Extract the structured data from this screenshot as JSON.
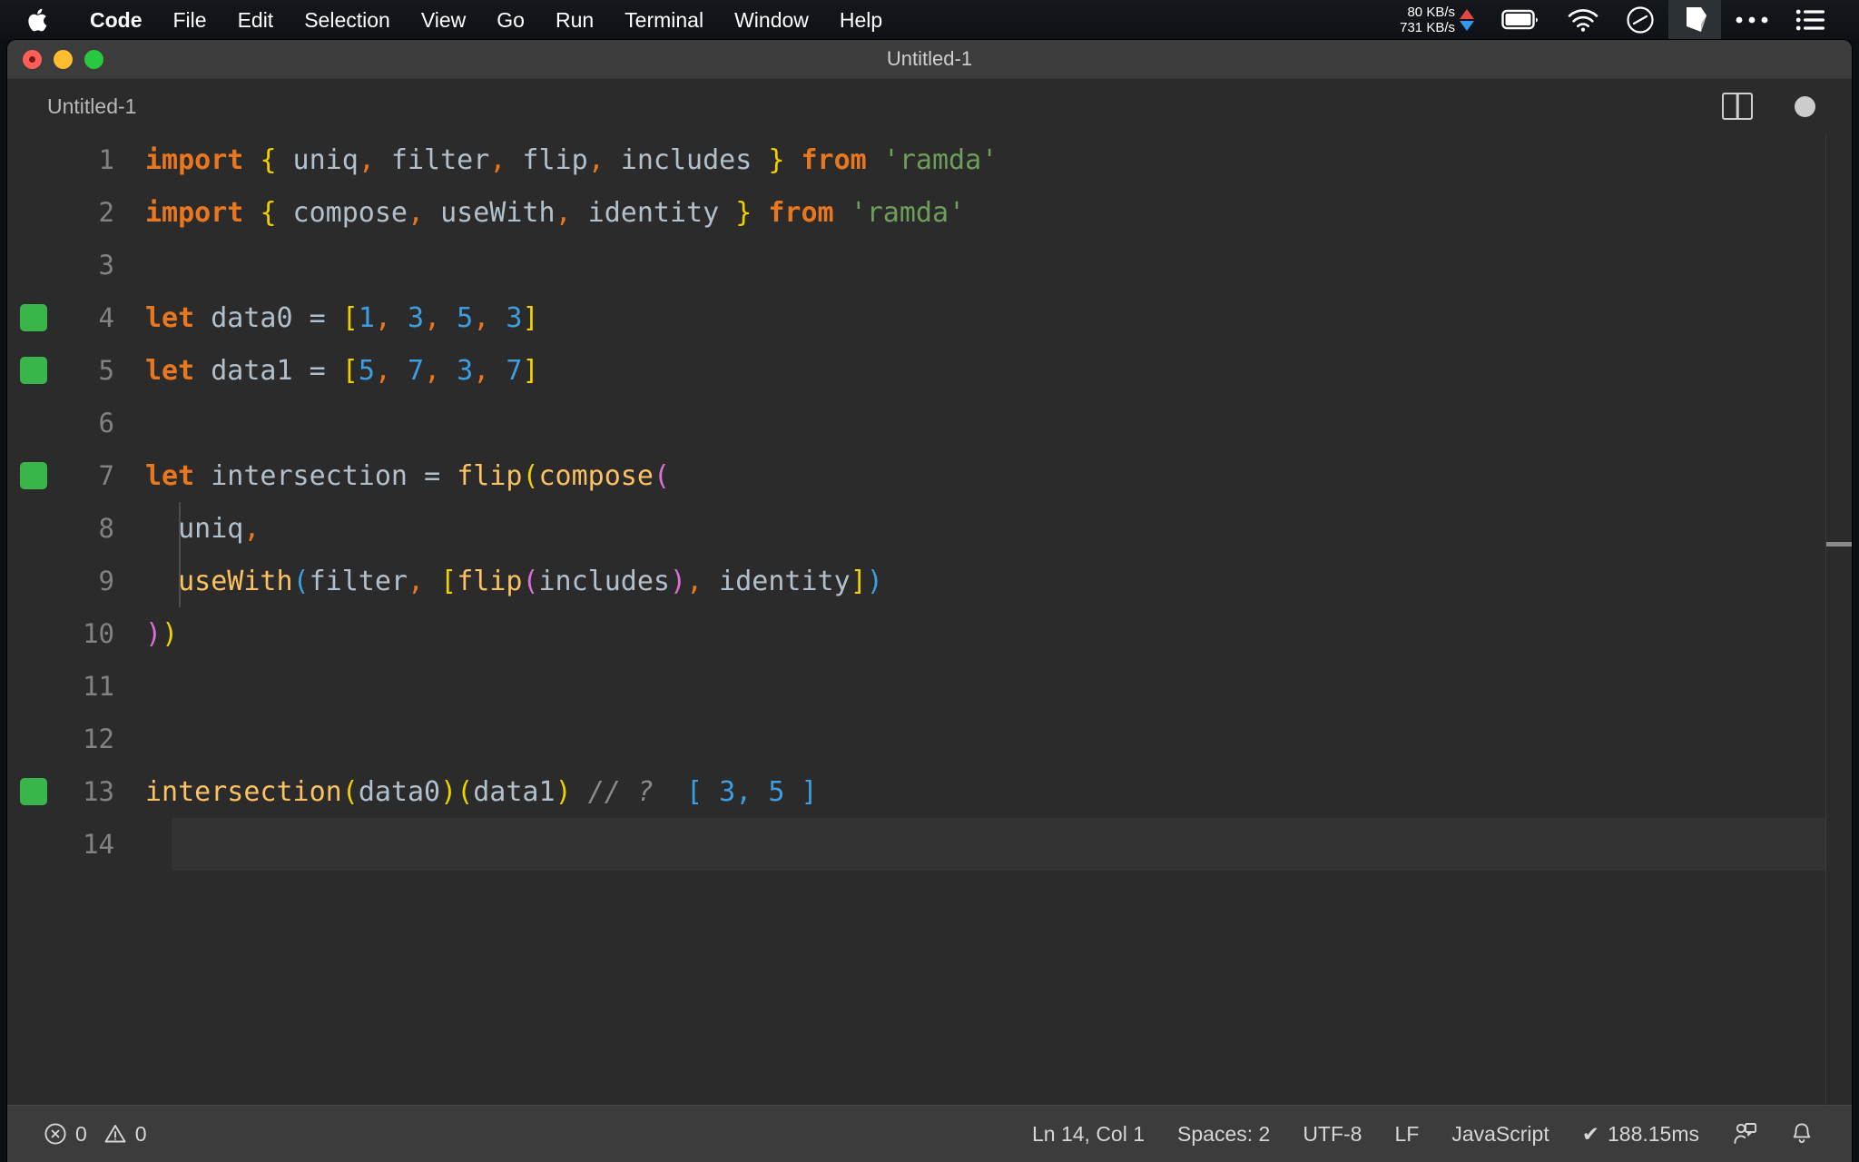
{
  "menubar": {
    "apple_icon": "apple-logo-icon",
    "items": [
      {
        "label": "Code",
        "bold": true
      },
      {
        "label": "File",
        "bold": false
      },
      {
        "label": "Edit",
        "bold": false
      },
      {
        "label": "Selection",
        "bold": false
      },
      {
        "label": "View",
        "bold": false
      },
      {
        "label": "Go",
        "bold": false
      },
      {
        "label": "Run",
        "bold": false
      },
      {
        "label": "Terminal",
        "bold": false
      },
      {
        "label": "Window",
        "bold": false
      },
      {
        "label": "Help",
        "bold": false
      }
    ],
    "network": {
      "upload": "80 KB/s",
      "download": "731 KB/s",
      "upload_color": "#e8453c",
      "download_color": "#2f9bf0"
    },
    "tray_icons": [
      "battery-icon",
      "wifi-icon",
      "do-not-disturb-icon",
      "dropbox-icon",
      "ellipsis-icon",
      "control-center-icon"
    ]
  },
  "window": {
    "title": "Untitled-1",
    "traffic_lights": [
      "close-button",
      "minimize-button",
      "maximize-button"
    ]
  },
  "tabbar": {
    "tabs": [
      {
        "label": "Untitled-1",
        "active": true
      }
    ],
    "actions": [
      "split-editor-icon",
      "unsaved-indicator"
    ]
  },
  "editor": {
    "language": "JavaScript",
    "current_line": 14,
    "lines": [
      {
        "n": "1",
        "marker": false,
        "indent_guide": false,
        "tokens": [
          {
            "t": "import",
            "c": "t-kw"
          },
          {
            "t": " ",
            "c": "t-id"
          },
          {
            "t": "{",
            "c": "b1"
          },
          {
            "t": " uniq",
            "c": "t-id"
          },
          {
            "t": ",",
            "c": "t-punc"
          },
          {
            "t": " filter",
            "c": "t-id"
          },
          {
            "t": ",",
            "c": "t-punc"
          },
          {
            "t": " flip",
            "c": "t-id"
          },
          {
            "t": ",",
            "c": "t-punc"
          },
          {
            "t": " includes ",
            "c": "t-id"
          },
          {
            "t": "}",
            "c": "b1"
          },
          {
            "t": " ",
            "c": "t-id"
          },
          {
            "t": "from",
            "c": "t-kw"
          },
          {
            "t": " ",
            "c": "t-id"
          },
          {
            "t": "'ramda'",
            "c": "t-str"
          }
        ]
      },
      {
        "n": "2",
        "marker": false,
        "indent_guide": false,
        "tokens": [
          {
            "t": "import",
            "c": "t-kw"
          },
          {
            "t": " ",
            "c": "t-id"
          },
          {
            "t": "{",
            "c": "b1"
          },
          {
            "t": " compose",
            "c": "t-id"
          },
          {
            "t": ",",
            "c": "t-punc"
          },
          {
            "t": " useWith",
            "c": "t-id"
          },
          {
            "t": ",",
            "c": "t-punc"
          },
          {
            "t": " identity ",
            "c": "t-id"
          },
          {
            "t": "}",
            "c": "b1"
          },
          {
            "t": " ",
            "c": "t-id"
          },
          {
            "t": "from",
            "c": "t-kw"
          },
          {
            "t": " ",
            "c": "t-id"
          },
          {
            "t": "'ramda'",
            "c": "t-str"
          }
        ]
      },
      {
        "n": "3",
        "marker": false,
        "indent_guide": false,
        "tokens": []
      },
      {
        "n": "4",
        "marker": true,
        "indent_guide": false,
        "tokens": [
          {
            "t": "let",
            "c": "t-kw"
          },
          {
            "t": " data0 ",
            "c": "t-id"
          },
          {
            "t": "=",
            "c": "t-op"
          },
          {
            "t": " ",
            "c": "t-id"
          },
          {
            "t": "[",
            "c": "b1"
          },
          {
            "t": "1",
            "c": "t-num"
          },
          {
            "t": ",",
            "c": "t-punc"
          },
          {
            "t": " 3",
            "c": "t-num"
          },
          {
            "t": ",",
            "c": "t-punc"
          },
          {
            "t": " 5",
            "c": "t-num"
          },
          {
            "t": ",",
            "c": "t-punc"
          },
          {
            "t": " 3",
            "c": "t-num"
          },
          {
            "t": "]",
            "c": "b1"
          }
        ]
      },
      {
        "n": "5",
        "marker": true,
        "indent_guide": false,
        "tokens": [
          {
            "t": "let",
            "c": "t-kw"
          },
          {
            "t": " data1 ",
            "c": "t-id"
          },
          {
            "t": "=",
            "c": "t-op"
          },
          {
            "t": " ",
            "c": "t-id"
          },
          {
            "t": "[",
            "c": "b1"
          },
          {
            "t": "5",
            "c": "t-num"
          },
          {
            "t": ",",
            "c": "t-punc"
          },
          {
            "t": " 7",
            "c": "t-num"
          },
          {
            "t": ",",
            "c": "t-punc"
          },
          {
            "t": " 3",
            "c": "t-num"
          },
          {
            "t": ",",
            "c": "t-punc"
          },
          {
            "t": " 7",
            "c": "t-num"
          },
          {
            "t": "]",
            "c": "b1"
          }
        ]
      },
      {
        "n": "6",
        "marker": false,
        "indent_guide": false,
        "tokens": []
      },
      {
        "n": "7",
        "marker": true,
        "indent_guide": false,
        "tokens": [
          {
            "t": "let",
            "c": "t-kw"
          },
          {
            "t": " intersection ",
            "c": "t-id"
          },
          {
            "t": "=",
            "c": "t-op"
          },
          {
            "t": " ",
            "c": "t-id"
          },
          {
            "t": "flip",
            "c": "t-fn"
          },
          {
            "t": "(",
            "c": "b1"
          },
          {
            "t": "compose",
            "c": "t-fn"
          },
          {
            "t": "(",
            "c": "b2"
          }
        ]
      },
      {
        "n": "8",
        "marker": false,
        "indent_guide": true,
        "tokens": [
          {
            "t": "  uniq",
            "c": "t-id"
          },
          {
            "t": ",",
            "c": "t-punc"
          }
        ]
      },
      {
        "n": "9",
        "marker": false,
        "indent_guide": true,
        "tokens": [
          {
            "t": "  ",
            "c": "t-id"
          },
          {
            "t": "useWith",
            "c": "t-fn"
          },
          {
            "t": "(",
            "c": "b3"
          },
          {
            "t": "filter",
            "c": "t-id"
          },
          {
            "t": ",",
            "c": "t-punc"
          },
          {
            "t": " ",
            "c": "t-id"
          },
          {
            "t": "[",
            "c": "b1"
          },
          {
            "t": "flip",
            "c": "t-fn"
          },
          {
            "t": "(",
            "c": "b2"
          },
          {
            "t": "includes",
            "c": "t-id"
          },
          {
            "t": ")",
            "c": "b2"
          },
          {
            "t": ",",
            "c": "t-punc"
          },
          {
            "t": " identity",
            "c": "t-id"
          },
          {
            "t": "]",
            "c": "b1"
          },
          {
            "t": ")",
            "c": "b3"
          }
        ]
      },
      {
        "n": "10",
        "marker": false,
        "indent_guide": false,
        "tokens": [
          {
            "t": ")",
            "c": "b2"
          },
          {
            "t": ")",
            "c": "b1"
          }
        ]
      },
      {
        "n": "11",
        "marker": false,
        "indent_guide": false,
        "tokens": []
      },
      {
        "n": "12",
        "marker": false,
        "indent_guide": false,
        "tokens": []
      },
      {
        "n": "13",
        "marker": true,
        "indent_guide": false,
        "tokens": [
          {
            "t": "intersection",
            "c": "t-fn"
          },
          {
            "t": "(",
            "c": "b1"
          },
          {
            "t": "data0",
            "c": "t-id"
          },
          {
            "t": ")",
            "c": "b1"
          },
          {
            "t": "(",
            "c": "b1"
          },
          {
            "t": "data1",
            "c": "t-id"
          },
          {
            "t": ")",
            "c": "b1"
          },
          {
            "t": " ",
            "c": "t-id"
          },
          {
            "t": "// ?",
            "c": "t-com"
          },
          {
            "t": "  [ 3, 5 ]",
            "c": "t-res"
          }
        ]
      },
      {
        "n": "14",
        "marker": false,
        "indent_guide": false,
        "current": true,
        "tokens": []
      }
    ]
  },
  "statusbar": {
    "errors_icon": "error-circle-icon",
    "errors": "0",
    "warnings_icon": "warning-triangle-icon",
    "warnings": "0",
    "position": "Ln 14, Col 1",
    "indentation": "Spaces: 2",
    "encoding": "UTF-8",
    "eol": "LF",
    "language": "JavaScript",
    "runtime_check": "✔",
    "runtime": "188.15ms",
    "feedback_icon": "feedback-person-icon",
    "bell_icon": "bell-icon"
  },
  "colors": {
    "editor_bg": "#2b2b2b",
    "titlebar_bg": "#3c3c3c",
    "keyword": "#e8771f",
    "function": "#fbc163",
    "string": "#6d9e5a",
    "number": "#3d9ee0",
    "bracket1": "#f2d000",
    "bracket2": "#da70d6",
    "bracket3": "#3d9ee0",
    "marker_green": "#3ab54a"
  }
}
